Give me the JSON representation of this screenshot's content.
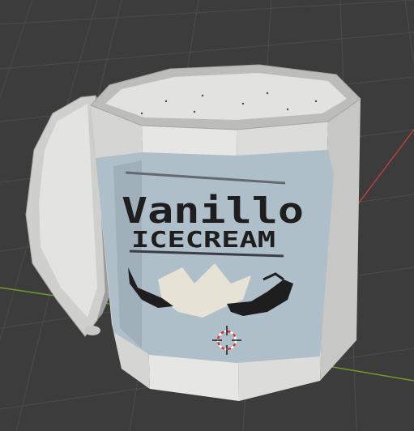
{
  "viewport": {
    "background": "#3c3c3c",
    "grid_color": "#4a4a4a",
    "x_axis_color": "#b4423f",
    "y_axis_color": "#6e9c2c"
  },
  "object": {
    "kind": "ice-cream-tub",
    "body_color": "#d8d9d6",
    "label_color": "#aebfc9",
    "label_line1": "Vanillo",
    "label_line2": "ICECREAM",
    "label_ink_color": "#1e1e1e"
  },
  "gizmo": {
    "icon": "3d-cursor-icon",
    "ring_color_a": "#d83a2f",
    "ring_color_b": "#ffffff"
  }
}
